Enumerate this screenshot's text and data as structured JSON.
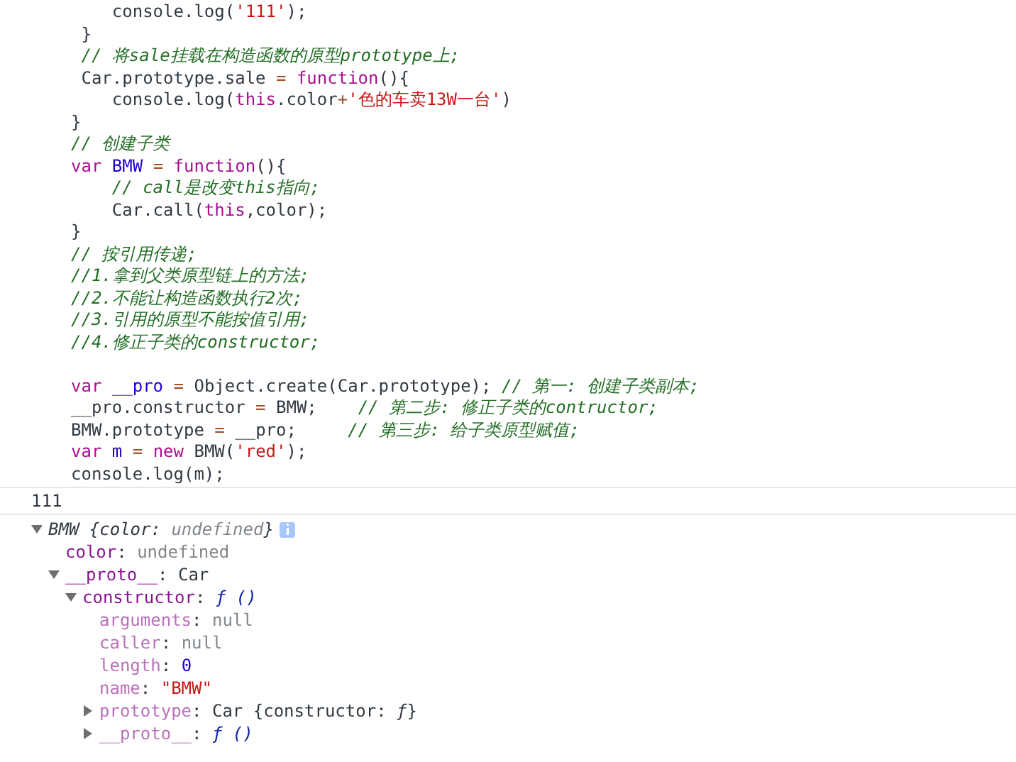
{
  "code_lines": [
    [
      {
        "text": "    console.log(",
        "kind": "plain"
      },
      {
        "text": "'111'",
        "kind": "string"
      },
      {
        "text": ");",
        "kind": "plain"
      }
    ],
    [
      {
        "text": " }",
        "kind": "plain"
      }
    ],
    [
      {
        "text": " // 将sale挂载在构造函数的原型prototype上;",
        "kind": "comment"
      }
    ],
    [
      {
        "text": " Car.prototype.sale ",
        "kind": "plain"
      },
      {
        "text": "=",
        "kind": "op"
      },
      {
        "text": " function",
        "kind": "keyword"
      },
      {
        "text": "(){",
        "kind": "plain"
      }
    ],
    [
      {
        "text": "    console.log(",
        "kind": "plain"
      },
      {
        "text": "this",
        "kind": "keyword"
      },
      {
        "text": ".color",
        "kind": "plain"
      },
      {
        "text": "+",
        "kind": "op"
      },
      {
        "text": "'色的车卖13W一台'",
        "kind": "string"
      },
      {
        "text": ")",
        "kind": "plain"
      }
    ],
    [
      {
        "text": "}",
        "kind": "plain"
      }
    ],
    [
      {
        "text": "// 创建子类",
        "kind": "comment"
      }
    ],
    [
      {
        "text": "var",
        "kind": "keyword"
      },
      {
        "text": " BMW",
        "kind": "name"
      },
      {
        "text": " =",
        "kind": "op"
      },
      {
        "text": " function",
        "kind": "keyword"
      },
      {
        "text": "(){",
        "kind": "plain"
      }
    ],
    [
      {
        "text": "    // call是改变this指向;",
        "kind": "comment"
      }
    ],
    [
      {
        "text": "    Car.call(",
        "kind": "plain"
      },
      {
        "text": "this",
        "kind": "keyword"
      },
      {
        "text": ",color);",
        "kind": "plain"
      }
    ],
    [
      {
        "text": "}",
        "kind": "plain"
      }
    ],
    [
      {
        "text": "// 按引用传递;",
        "kind": "comment"
      }
    ],
    [
      {
        "text": "//1.拿到父类原型链上的方法;",
        "kind": "comment"
      }
    ],
    [
      {
        "text": "//2.不能让构造函数执行2次;",
        "kind": "comment"
      }
    ],
    [
      {
        "text": "//3.引用的原型不能按值引用;",
        "kind": "comment"
      }
    ],
    [
      {
        "text": "//4.修正子类的constructor;",
        "kind": "comment"
      }
    ],
    [
      {
        "text": "var",
        "kind": "keyword",
        "blank_before": true
      },
      {
        "text": " __pro",
        "kind": "name"
      },
      {
        "text": " =",
        "kind": "op"
      },
      {
        "text": " Object.create(Car.prototype); ",
        "kind": "plain"
      },
      {
        "text": "// 第一: 创建子类副本;",
        "kind": "comment"
      }
    ],
    [
      {
        "text": "__pro.constructor ",
        "kind": "plain"
      },
      {
        "text": "=",
        "kind": "op"
      },
      {
        "text": " BMW;    ",
        "kind": "plain"
      },
      {
        "text": "// 第二步: 修正子类的contructor;",
        "kind": "comment"
      }
    ],
    [
      {
        "text": "BMW.prototype ",
        "kind": "plain"
      },
      {
        "text": "=",
        "kind": "op"
      },
      {
        "text": " __pro;     ",
        "kind": "plain"
      },
      {
        "text": "// 第三步: 给子类原型赋值;",
        "kind": "comment"
      }
    ],
    [
      {
        "text": "var",
        "kind": "keyword"
      },
      {
        "text": " m",
        "kind": "name"
      },
      {
        "text": " =",
        "kind": "op"
      },
      {
        "text": " new",
        "kind": "keyword"
      },
      {
        "text": " BMW(",
        "kind": "plain"
      },
      {
        "text": "'red'",
        "kind": "string"
      },
      {
        "text": ");",
        "kind": "plain"
      }
    ],
    [
      {
        "text": "console.log(m);",
        "kind": "plain"
      }
    ]
  ],
  "console_messages": [
    {
      "text": "111"
    }
  ],
  "object_tree": {
    "expanded": true,
    "info_badge": true,
    "tokens": [
      {
        "text": "BMW {color: ",
        "kind": "summary"
      },
      {
        "text": "undefined",
        "kind": "summary-dim"
      },
      {
        "text": "}",
        "kind": "summary"
      }
    ],
    "children": [
      {
        "tokens": [
          {
            "text": "color",
            "kind": "key"
          },
          {
            "text": ": ",
            "kind": "plain"
          },
          {
            "text": "undefined",
            "kind": "undef"
          }
        ]
      },
      {
        "expanded": true,
        "tokens": [
          {
            "text": "__proto__",
            "kind": "key"
          },
          {
            "text": ": Car",
            "kind": "plain"
          }
        ],
        "children": [
          {
            "expanded": true,
            "tokens": [
              {
                "text": "constructor",
                "kind": "key"
              },
              {
                "text": ": ",
                "kind": "plain"
              },
              {
                "text": "ƒ ()",
                "kind": "func"
              }
            ],
            "children": [
              {
                "tokens": [
                  {
                    "text": "arguments",
                    "kind": "key-dim"
                  },
                  {
                    "text": ": ",
                    "kind": "plain"
                  },
                  {
                    "text": "null",
                    "kind": "undef"
                  }
                ]
              },
              {
                "tokens": [
                  {
                    "text": "caller",
                    "kind": "key-dim"
                  },
                  {
                    "text": ": ",
                    "kind": "plain"
                  },
                  {
                    "text": "null",
                    "kind": "undef"
                  }
                ]
              },
              {
                "tokens": [
                  {
                    "text": "length",
                    "kind": "key-dim"
                  },
                  {
                    "text": ": ",
                    "kind": "plain"
                  },
                  {
                    "text": "0",
                    "kind": "number"
                  }
                ]
              },
              {
                "tokens": [
                  {
                    "text": "name",
                    "kind": "key-dim"
                  },
                  {
                    "text": ": ",
                    "kind": "plain"
                  },
                  {
                    "text": "\"BMW\"",
                    "kind": "string"
                  }
                ]
              },
              {
                "expanded": false,
                "tokens": [
                  {
                    "text": "prototype",
                    "kind": "key-dim"
                  },
                  {
                    "text": ": Car {constructor: ",
                    "kind": "plain"
                  },
                  {
                    "text": "ƒ",
                    "kind": "func-plain"
                  },
                  {
                    "text": "}",
                    "kind": "plain"
                  }
                ]
              },
              {
                "expanded": false,
                "tokens": [
                  {
                    "text": "__proto__",
                    "kind": "key-dim"
                  },
                  {
                    "text": ": ",
                    "kind": "plain"
                  },
                  {
                    "text": "ƒ ()",
                    "kind": "func"
                  }
                ]
              }
            ]
          }
        ]
      }
    ]
  }
}
